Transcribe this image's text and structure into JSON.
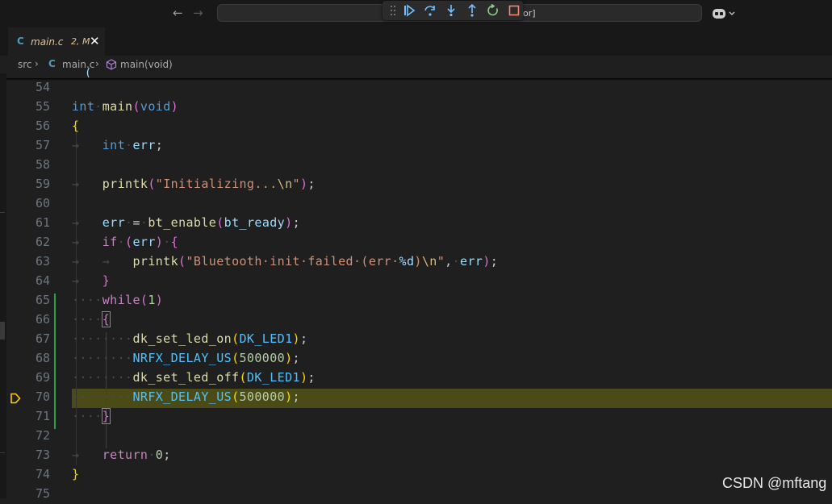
{
  "command_center": {
    "text": "or]"
  },
  "tab": {
    "file_icon": "C",
    "label": "main.c",
    "status": "2, M",
    "close": "✕"
  },
  "breadcrumb": {
    "folder": "src",
    "separator": "›",
    "file_icon": "C",
    "file": "main.c",
    "symbol": "main(void)"
  },
  "sticky_fragment": "   _    ( ",
  "editor": {
    "line_numbers": [
      "54",
      "55",
      "56",
      "57",
      "58",
      "59",
      "60",
      "61",
      "62",
      "63",
      "64",
      "65",
      "66",
      "67",
      "68",
      "69",
      "70",
      "71",
      "72",
      "73",
      "74",
      "75"
    ],
    "current_line": "70"
  },
  "colors": {
    "background": "#1f1f1f",
    "current_line": "#4b4b18",
    "git_modified": "#2ea043",
    "debug_arrow": "#ffcc00"
  },
  "watermark": "CSDN @mftang"
}
